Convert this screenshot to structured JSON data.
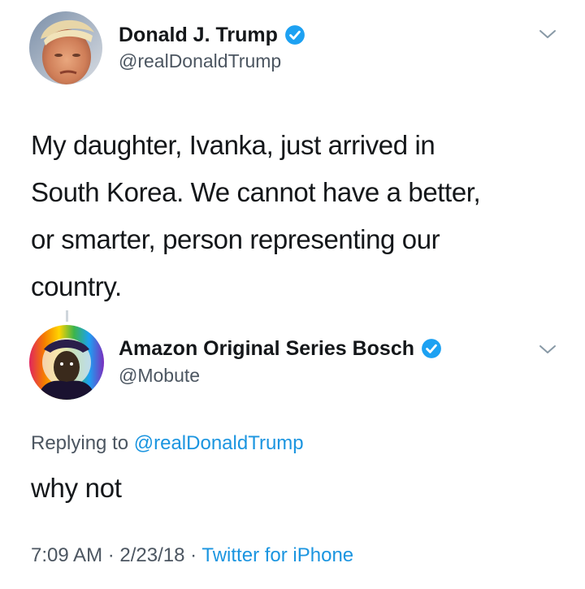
{
  "tweet": {
    "author": {
      "display_name": "Donald J. Trump",
      "handle": "@realDonaldTrump",
      "verified": true
    },
    "text_lines": [
      "My daughter, Ivanka, just arrived in",
      "South Korea. We cannot have a better,",
      "or smarter, person representing our",
      "country."
    ]
  },
  "reply": {
    "author": {
      "display_name": "Amazon Original Series Bosch",
      "handle": "@Mobute",
      "verified": true
    },
    "replying_prefix": "Replying to",
    "replying_handle": "@realDonaldTrump",
    "text": "why not",
    "time": "7:09 AM",
    "date": "2/23/18",
    "separator": "·",
    "source": "Twitter for iPhone"
  },
  "colors": {
    "verified_blue": "#1da1f2",
    "link_blue": "#1b95e0",
    "secondary_text": "#4c5661",
    "primary_text": "#14171a"
  },
  "icons": [
    "verified-badge-icon",
    "chevron-down-icon"
  ]
}
